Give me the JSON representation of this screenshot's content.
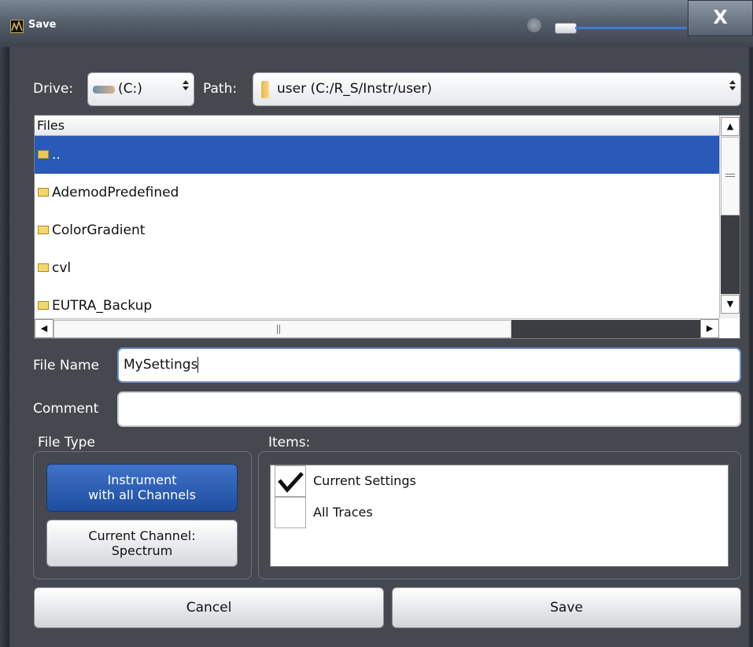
{
  "window": {
    "title": "Save",
    "close_label": "X"
  },
  "drive": {
    "label": "Drive:",
    "value": "(C:)"
  },
  "path": {
    "label": "Path:",
    "value": "user (C:/R_S/Instr/user)"
  },
  "files": {
    "header": "Files",
    "rows": [
      "..",
      "AdemodPredefined",
      "ColorGradient",
      "cvl",
      "EUTRA_Backup"
    ],
    "selected_index": 0,
    "scroll_up": "▲",
    "scroll_down": "▼",
    "scroll_left": "◀",
    "scroll_right": "▶"
  },
  "file_name": {
    "label": "File Name",
    "value": "MySettings"
  },
  "comment": {
    "label": "Comment",
    "value": ""
  },
  "file_type": {
    "label": "File Type",
    "options": [
      {
        "line1": "Instrument",
        "line2": "with all Channels",
        "selected": true
      },
      {
        "line1": "Current Channel:",
        "line2": "Spectrum",
        "selected": false
      }
    ]
  },
  "items": {
    "label": "Items:",
    "entries": [
      {
        "label": "Current Settings",
        "checked": true
      },
      {
        "label": "All Traces",
        "checked": false
      }
    ]
  },
  "buttons": {
    "cancel": "Cancel",
    "save": "Save"
  },
  "colors": {
    "selection": "#2a5ab7",
    "panel": "#45494f",
    "accent": "#3f72c9"
  }
}
